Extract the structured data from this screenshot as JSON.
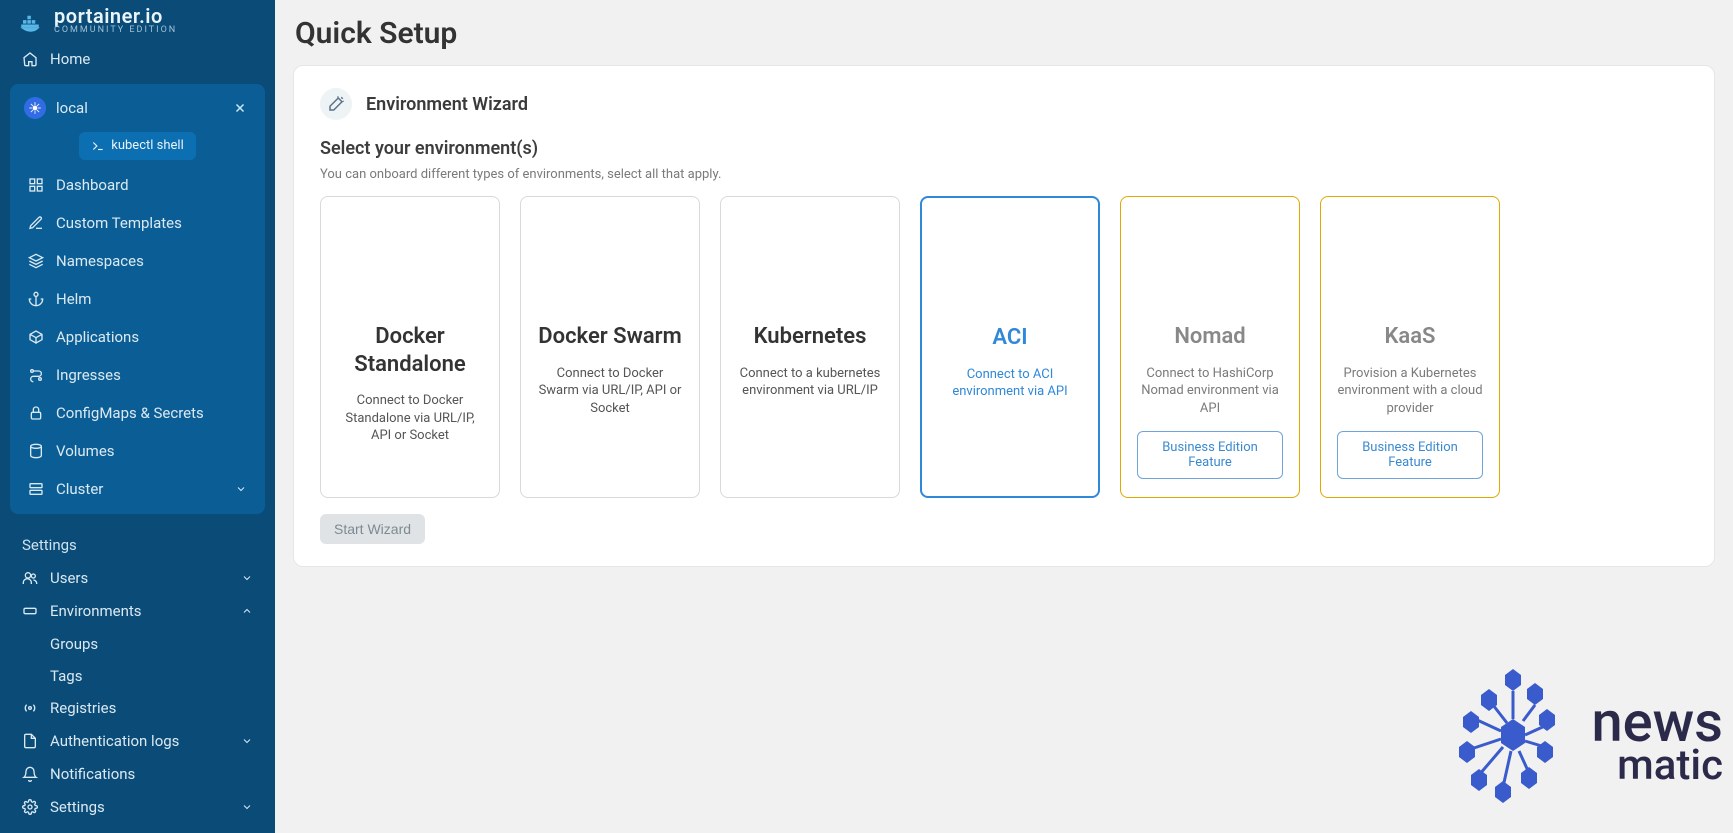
{
  "brand": {
    "name": "portainer.io",
    "edition": "COMMUNITY EDITION"
  },
  "sidebar": {
    "home": "Home",
    "env_name": "local",
    "kubectl": "kubectl shell",
    "items": [
      {
        "label": "Dashboard"
      },
      {
        "label": "Custom Templates"
      },
      {
        "label": "Namespaces"
      },
      {
        "label": "Helm"
      },
      {
        "label": "Applications"
      },
      {
        "label": "Ingresses"
      },
      {
        "label": "ConfigMaps & Secrets"
      },
      {
        "label": "Volumes"
      },
      {
        "label": "Cluster",
        "chev": "down"
      }
    ],
    "settings_title": "Settings",
    "settings": [
      {
        "label": "Users",
        "chev": "down"
      },
      {
        "label": "Environments",
        "chev": "up",
        "children": [
          "Groups",
          "Tags"
        ]
      },
      {
        "label": "Registries"
      },
      {
        "label": "Authentication logs",
        "chev": "down"
      },
      {
        "label": "Notifications"
      },
      {
        "label": "Settings",
        "chev": "down"
      }
    ]
  },
  "page": {
    "title": "Quick Setup",
    "wizard_title": "Environment Wizard",
    "prompt": "Select your environment(s)",
    "hint": "You can onboard different types of environments, select all that apply.",
    "start_btn": "Start Wizard"
  },
  "cards": [
    {
      "title": "Docker Standalone",
      "desc": "Connect to Docker Standalone via URL/IP, API or Socket",
      "state": "normal"
    },
    {
      "title": "Docker Swarm",
      "desc": "Connect to Docker Swarm via URL/IP, API or Socket",
      "state": "normal"
    },
    {
      "title": "Kubernetes",
      "desc": "Connect to a kubernetes environment via URL/IP",
      "state": "normal"
    },
    {
      "title": "ACI",
      "desc": "Connect to ACI environment via API",
      "state": "selected"
    },
    {
      "title": "Nomad",
      "desc": "Connect to HashiCorp Nomad environment via API",
      "state": "be",
      "badge": "Business Edition Feature"
    },
    {
      "title": "KaaS",
      "desc": "Provision a Kubernetes environment with a cloud provider",
      "state": "be",
      "badge": "Business Edition Feature"
    }
  ],
  "watermark": {
    "line1": "news",
    "line2": "matic"
  }
}
